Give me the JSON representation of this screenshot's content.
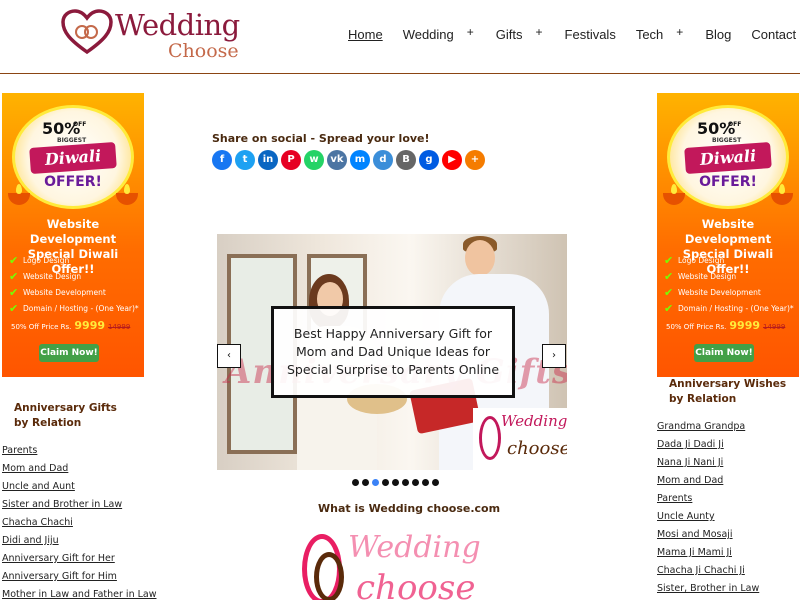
{
  "header": {
    "logo_line1": "Wedding",
    "logo_line2": "Choose",
    "nav": [
      {
        "label": "Home",
        "active": true,
        "has_submenu": false
      },
      {
        "label": "Wedding",
        "active": false,
        "has_submenu": true
      },
      {
        "label": "Gifts",
        "active": false,
        "has_submenu": true
      },
      {
        "label": "Festivals",
        "active": false,
        "has_submenu": false
      },
      {
        "label": "Tech",
        "active": false,
        "has_submenu": true
      },
      {
        "label": "Blog",
        "active": false,
        "has_submenu": false
      },
      {
        "label": "Contact",
        "active": false,
        "has_submenu": false
      }
    ],
    "submenu_symbol": "+"
  },
  "ad": {
    "percent": "50%",
    "off": "OFF",
    "biggest": "BIGGEST",
    "diwali": "Diwali",
    "offer": "OFFER!",
    "title_line1": "Website Development",
    "title_line2": "Special Diwali Offer!!",
    "items": [
      "Logo Design",
      "Website Design",
      "Website Development",
      "Domain / Hosting - (One Year)*"
    ],
    "price_label": "50% Off Price Rs.",
    "price_new": "9999",
    "price_old": "14999",
    "claim": "Claim Now!"
  },
  "left_sidebar": {
    "heading": "Anniversary Gifts by Relation",
    "items": [
      "Parents",
      "Mom and Dad",
      "Uncle and Aunt",
      "Sister and Brother in Law",
      "Chacha Chachi",
      "Didi and Jiju",
      "Anniversary Gift for Her",
      "Anniversary Gift for Him",
      "Mother in Law and Father in Law"
    ]
  },
  "right_sidebar": {
    "heading": "Anniversary Wishes by Relation",
    "items": [
      "Grandma Grandpa",
      "Dada Ji Dadi Ji",
      "Nana Ji Nani Ji",
      "Mom and Dad",
      "Parents",
      "Uncle Aunty",
      "Mosi and Mosaji",
      "Mama Ji Mami Ji",
      "Chacha Ji Chachi Ji",
      "Sister, Brother in Law"
    ]
  },
  "share": {
    "title": "Share on social - Spread your love!",
    "icons": [
      {
        "name": "facebook-icon",
        "glyph": "f",
        "color": "#1877f2"
      },
      {
        "name": "twitter-icon",
        "glyph": "t",
        "color": "#1da1f2"
      },
      {
        "name": "linkedin-icon",
        "glyph": "in",
        "color": "#0a66c2"
      },
      {
        "name": "pinterest-icon",
        "glyph": "P",
        "color": "#e60023"
      },
      {
        "name": "whatsapp-icon",
        "glyph": "w",
        "color": "#25d366"
      },
      {
        "name": "vk-icon",
        "glyph": "vk",
        "color": "#4c75a3"
      },
      {
        "name": "messenger-icon",
        "glyph": "m",
        "color": "#0084ff"
      },
      {
        "name": "odnoklassniki-icon",
        "glyph": "d",
        "color": "#3b8ed9"
      },
      {
        "name": "blogger-icon",
        "glyph": "B",
        "color": "#666666"
      },
      {
        "name": "digg-icon",
        "glyph": "g",
        "color": "#005be2"
      },
      {
        "name": "youtube-icon",
        "glyph": "▶",
        "color": "#ff0000"
      },
      {
        "name": "more-icon",
        "glyph": "+",
        "color": "#f57c00"
      }
    ]
  },
  "slider": {
    "caption": "Best Happy Anniversary Gift for Mom and Dad Unique Ideas for Special Surprise to Parents Online",
    "watermark": "Anniversary Gifts",
    "mini_logo_line1": "Wedding",
    "mini_logo_line2": "choose",
    "prev": "‹",
    "next": "›",
    "dot_count": 9,
    "active_dot": 2
  },
  "about": {
    "title": "What is Wedding choose.com",
    "logo_line1": "Wedding",
    "logo_line2": "choose"
  }
}
